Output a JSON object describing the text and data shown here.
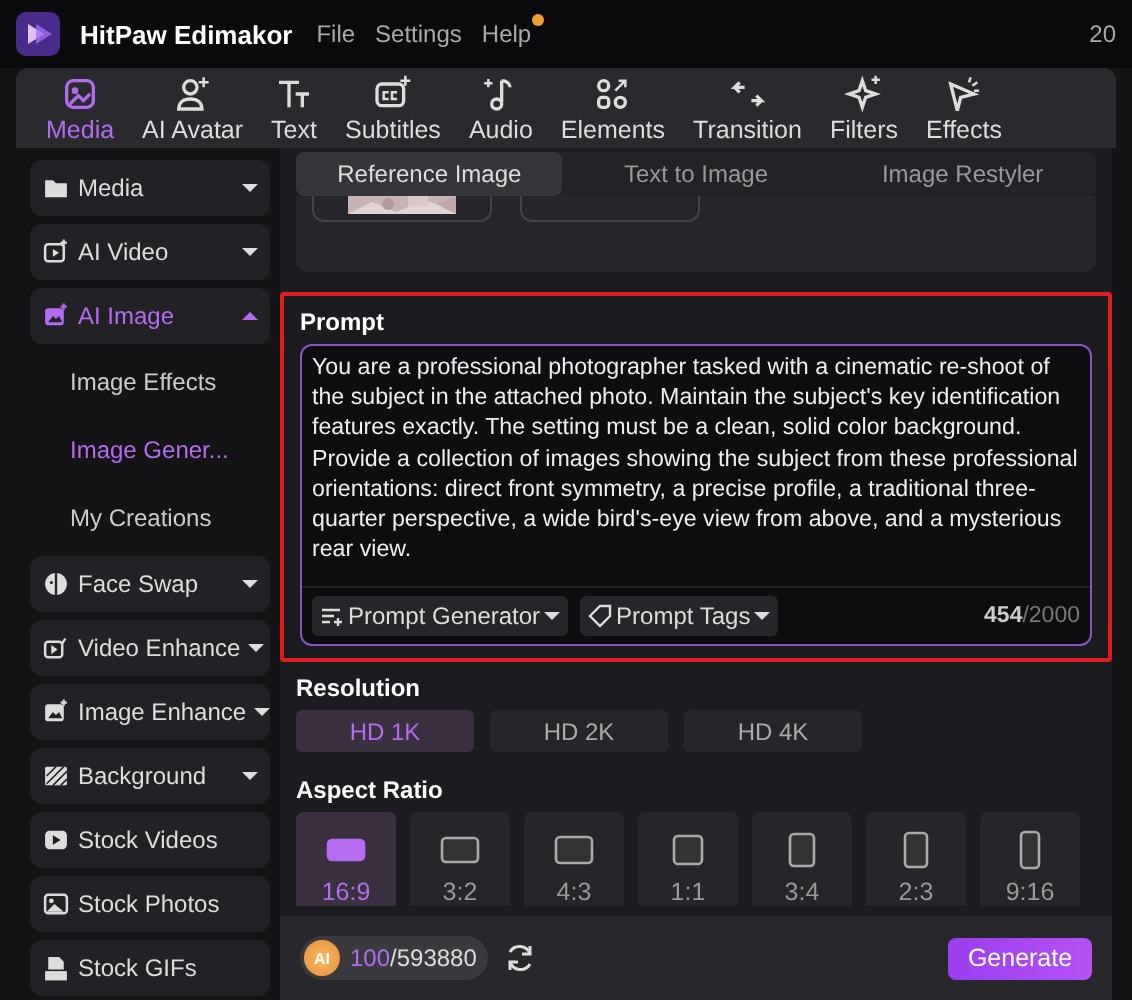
{
  "app": {
    "name": "HitPaw Edimakor",
    "menu": [
      {
        "label": "File",
        "notification": false
      },
      {
        "label": "Settings",
        "notification": false
      },
      {
        "label": "Help",
        "notification": true
      }
    ],
    "clock": "20"
  },
  "toolbar": [
    {
      "label": "Media",
      "selected": true
    },
    {
      "label": "AI Avatar",
      "selected": false
    },
    {
      "label": "Text",
      "selected": false
    },
    {
      "label": "Subtitles",
      "selected": false
    },
    {
      "label": "Audio",
      "selected": false
    },
    {
      "label": "Elements",
      "selected": false
    },
    {
      "label": "Transition",
      "selected": false
    },
    {
      "label": "Filters",
      "selected": false
    },
    {
      "label": "Effects",
      "selected": false
    }
  ],
  "sidebar": {
    "items": [
      {
        "label": "Media",
        "selected": false,
        "expanded": false
      },
      {
        "label": "AI Video",
        "selected": false,
        "expanded": false
      },
      {
        "label": "AI Image",
        "selected": true,
        "expanded": true,
        "children": [
          {
            "label": "Image Effects",
            "selected": false
          },
          {
            "label": "Image Gener...",
            "selected": true
          },
          {
            "label": "My Creations",
            "selected": false
          }
        ]
      },
      {
        "label": "Face Swap",
        "selected": false,
        "expanded": false
      },
      {
        "label": "Video Enhance",
        "selected": false,
        "expanded": false
      },
      {
        "label": "Image Enhance",
        "selected": false,
        "expanded": false
      },
      {
        "label": "Background",
        "selected": false,
        "expanded": false
      },
      {
        "label": "Stock Videos",
        "selected": false
      },
      {
        "label": "Stock Photos",
        "selected": false
      },
      {
        "label": "Stock GIFs",
        "selected": false
      }
    ]
  },
  "mode_tabs": [
    {
      "label": "Reference Image",
      "selected": true
    },
    {
      "label": "Text to Image",
      "selected": false
    },
    {
      "label": "Image Restyler",
      "selected": false
    }
  ],
  "reference_images": [
    {
      "kind": "picture"
    },
    {
      "kind": "empty"
    }
  ],
  "prompt": {
    "label": "Prompt",
    "highlighted": true,
    "value": "You are a professional photographer tasked with a cinematic re-shoot of the subject in the attached photo. Maintain the subject's key identification features exactly. The setting must be a clean, solid color background. Provide a collection of images showing the subject from these professional orientations: direct front symmetry, a precise profile, a traditional three-quarter perspective, a wide bird's-eye view from above, and a mysterious rear view.",
    "tools": [
      "Prompt Generator",
      "Prompt Tags"
    ],
    "count": "454",
    "limit": "/2000"
  },
  "resolution": {
    "label": "Resolution",
    "options": [
      {
        "label": "HD 1K",
        "selected": true
      },
      {
        "label": "HD 2K",
        "selected": false
      },
      {
        "label": "HD 4K",
        "selected": false
      }
    ]
  },
  "aspect_ratio": {
    "label": "Aspect Ratio",
    "options": [
      {
        "label": "16:9",
        "selected": true
      },
      {
        "label": "3:2",
        "selected": false
      },
      {
        "label": "4:3",
        "selected": false
      },
      {
        "label": "1:1",
        "selected": false
      },
      {
        "label": "3:4",
        "selected": false
      },
      {
        "label": "2:3",
        "selected": false
      },
      {
        "label": "9:16",
        "selected": false
      }
    ]
  },
  "footer": {
    "coin": "AI",
    "credits_used": "100",
    "credits_total": "/593880",
    "generate": "Generate"
  }
}
